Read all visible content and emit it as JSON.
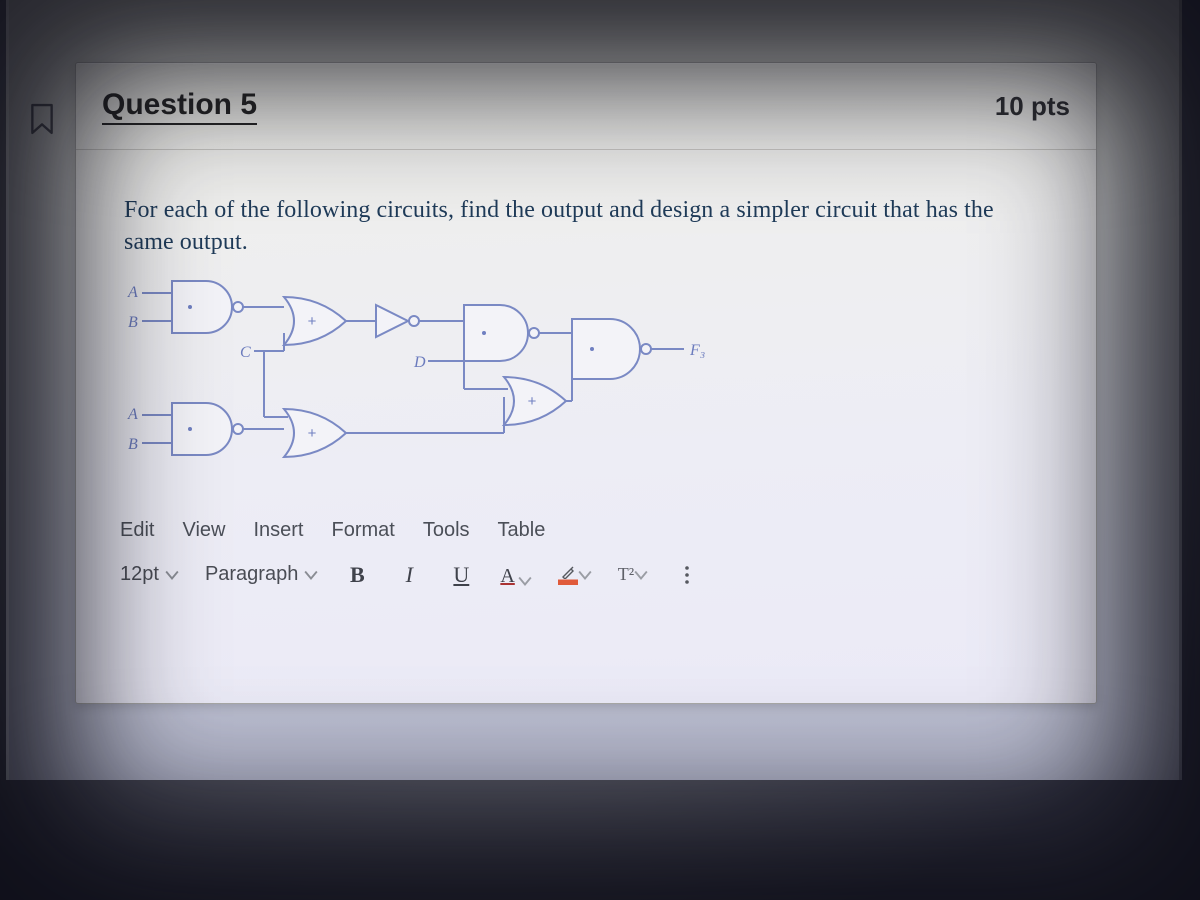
{
  "header": {
    "title": "Question 5",
    "points": "10 pts"
  },
  "prompt": "For each of the following circuits, find the output and design a simpler circuit that has the same output.",
  "circuit_labels": {
    "a1": "A",
    "b1": "B",
    "c": "C",
    "d": "D",
    "a2": "A",
    "b2": "B",
    "out": "F₃"
  },
  "editor": {
    "menubar": [
      "Edit",
      "View",
      "Insert",
      "Format",
      "Tools",
      "Table"
    ],
    "font_size": "12pt",
    "paragraph_style": "Paragraph",
    "bold": "B",
    "italic": "I",
    "underline": "U",
    "text_color": "A",
    "superscript": "T²"
  }
}
